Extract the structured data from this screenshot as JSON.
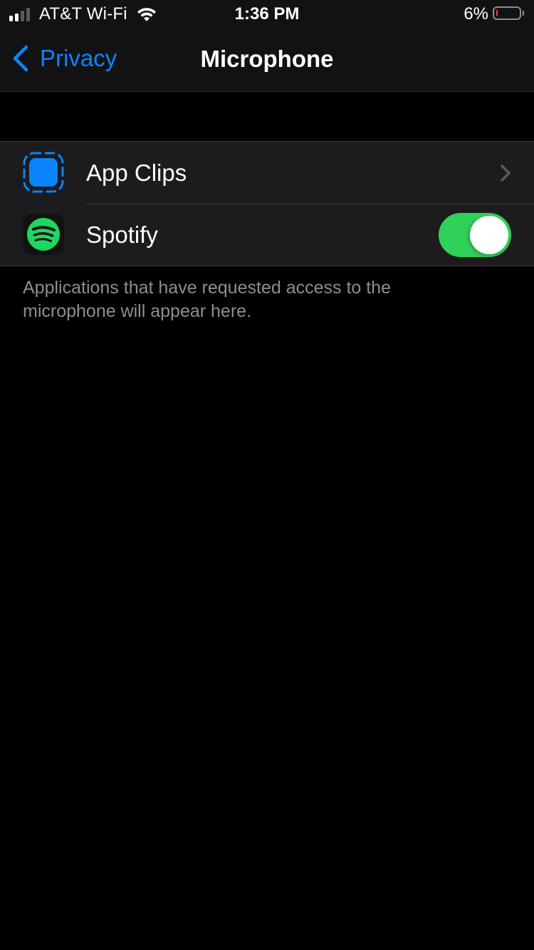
{
  "status_bar": {
    "carrier": "AT&T Wi-Fi",
    "signal_bars_active": 2,
    "signal_bars_total": 4,
    "time": "1:36 PM",
    "battery_percent_label": "6%",
    "battery_level": 0.06,
    "battery_color": "#ff3b30"
  },
  "nav": {
    "back_label": "Privacy",
    "title": "Microphone",
    "accent_color": "#0a84ff"
  },
  "list": {
    "items": [
      {
        "label": "App Clips",
        "icon": "app-clips-icon",
        "accessory": "chevron"
      },
      {
        "label": "Spotify",
        "icon": "spotify-icon",
        "accessory": "toggle",
        "enabled": true
      }
    ]
  },
  "footer": {
    "note": "Applications that have requested access to the microphone will appear here."
  },
  "colors": {
    "toggle_on": "#30d158",
    "app_clips_blue": "#0a84ff",
    "spotify_green": "#1ed760"
  }
}
